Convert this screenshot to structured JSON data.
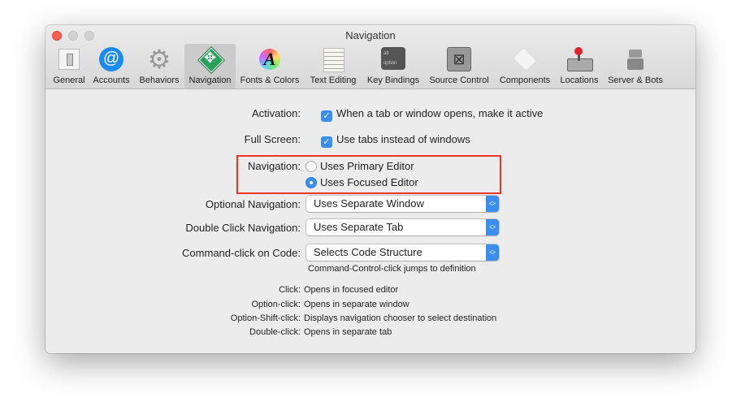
{
  "window": {
    "title": "Navigation"
  },
  "toolbar": {
    "items": [
      {
        "label": "General",
        "icon": "general-switch-icon"
      },
      {
        "label": "Accounts",
        "icon": "at-sign-icon"
      },
      {
        "label": "Behaviors",
        "icon": "gear-icon"
      },
      {
        "label": "Navigation",
        "icon": "navigation-arrows-icon",
        "selected": true
      },
      {
        "label": "Fonts & Colors",
        "icon": "font-color-wheel-icon"
      },
      {
        "label": "Text Editing",
        "icon": "notepad-pencil-icon"
      },
      {
        "label": "Key Bindings",
        "icon": "option-key-icon"
      },
      {
        "label": "Source Control",
        "icon": "safe-icon"
      },
      {
        "label": "Components",
        "icon": "cube-icon"
      },
      {
        "label": "Locations",
        "icon": "hard-drive-joystick-icon"
      },
      {
        "label": "Server & Bots",
        "icon": "robot-icon"
      }
    ],
    "key_icon_text": [
      "alt",
      "option"
    ]
  },
  "form": {
    "activation": {
      "label": "Activation:",
      "text": "When a tab or window opens, make it active",
      "checked": true
    },
    "full_screen": {
      "label": "Full Screen:",
      "text": "Use tabs instead of windows",
      "checked": true
    },
    "navigation": {
      "label": "Navigation:",
      "options": [
        "Uses Primary Editor",
        "Uses Focused Editor"
      ],
      "selected": "Uses Focused Editor"
    },
    "optional_navigation": {
      "label": "Optional Navigation:",
      "value": "Uses Separate Window"
    },
    "double_click_navigation": {
      "label": "Double Click Navigation:",
      "value": "Uses Separate Tab"
    },
    "command_click": {
      "label": "Command-click on Code:",
      "value": "Selects Code Structure",
      "hint": "Command-Control-click jumps to definition"
    }
  },
  "summary": [
    {
      "label": "Click:",
      "value": "Opens in focused editor"
    },
    {
      "label": "Option-click:",
      "value": "Opens in separate window"
    },
    {
      "label": "Option-Shift-click:",
      "value": "Displays navigation chooser to select destination"
    },
    {
      "label": "Double-click:",
      "value": "Opens in separate tab"
    }
  ],
  "colors": {
    "accent": "#3b8ef0",
    "highlight_box": "#ee3224"
  }
}
